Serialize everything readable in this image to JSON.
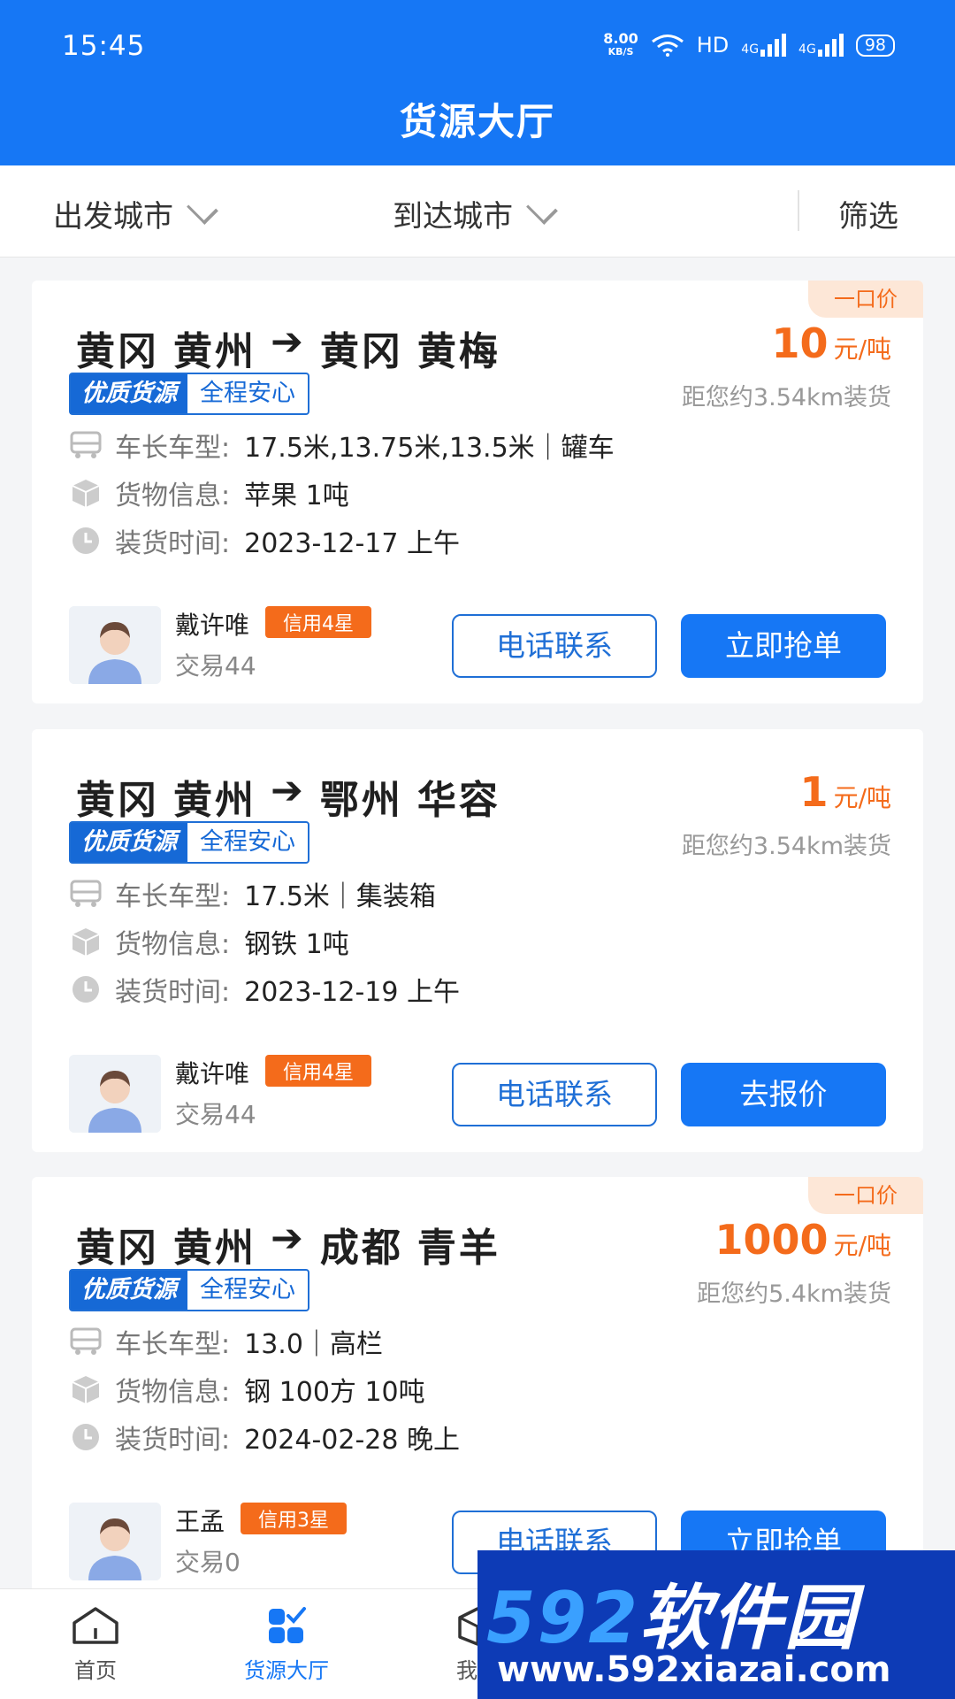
{
  "status_bar": {
    "time": "15:45",
    "speed_value": "8.00",
    "speed_unit": "KB/S",
    "hd": "HD",
    "net1": "4G",
    "net2": "4G",
    "battery": "98"
  },
  "header": {
    "title": "货源大厅"
  },
  "filters": {
    "departure": "出发城市",
    "arrival": "到达城市",
    "filter": "筛选"
  },
  "cards": [
    {
      "tag": "一口价",
      "from_city": "黄冈",
      "from_district": "黄州",
      "to_city": "黄冈",
      "to_district": "黄梅",
      "price": "10",
      "price_unit": "元/吨",
      "badge_a": "优质货源",
      "badge_b": "全程安心",
      "distance": "距您约3.54km装货",
      "vehicle_label": "车长车型:",
      "vehicle": "17.5米,13.75米,13.5米｜罐车",
      "cargo_label": "货物信息:",
      "cargo": "苹果 1吨",
      "time_label": "装货时间:",
      "time": "2023-12-17 上午",
      "seller_name": "戴许唯",
      "credit": "信用4星",
      "trades": "交易44",
      "btn_call": "电话联系",
      "btn_action": "立即抢单"
    },
    {
      "tag": "",
      "from_city": "黄冈",
      "from_district": "黄州",
      "to_city": "鄂州",
      "to_district": "华容",
      "price": "1",
      "price_unit": "元/吨",
      "badge_a": "优质货源",
      "badge_b": "全程安心",
      "distance": "距您约3.54km装货",
      "vehicle_label": "车长车型:",
      "vehicle": "17.5米｜集装箱",
      "cargo_label": "货物信息:",
      "cargo": "钢铁 1吨",
      "time_label": "装货时间:",
      "time": "2023-12-19 上午",
      "seller_name": "戴许唯",
      "credit": "信用4星",
      "trades": "交易44",
      "btn_call": "电话联系",
      "btn_action": "去报价"
    },
    {
      "tag": "一口价",
      "from_city": "黄冈",
      "from_district": "黄州",
      "to_city": "成都",
      "to_district": "青羊",
      "price": "1000",
      "price_unit": "元/吨",
      "badge_a": "优质货源",
      "badge_b": "全程安心",
      "distance": "距您约5.4km装货",
      "vehicle_label": "车长车型:",
      "vehicle": "13.0｜高栏",
      "cargo_label": "货物信息:",
      "cargo": "钢 100方 10吨",
      "time_label": "装货时间:",
      "time": "2024-02-28 晚上",
      "seller_name": "王孟",
      "credit": "信用3星",
      "trades": "交易0",
      "btn_call": "电话联系",
      "btn_action": "立即抢单"
    }
  ],
  "bottom_nav": [
    {
      "label": "首页",
      "icon": "home-icon"
    },
    {
      "label": "货源大厅",
      "icon": "cargo-hall-icon",
      "active": true
    },
    {
      "label": "我的",
      "icon": "box-icon"
    }
  ],
  "watermark": {
    "logo_num": "592",
    "logo_text": "软件园",
    "url": "www.592xiazai.com"
  },
  "colors": {
    "primary": "#1677f5",
    "accent": "#f46b1b"
  }
}
